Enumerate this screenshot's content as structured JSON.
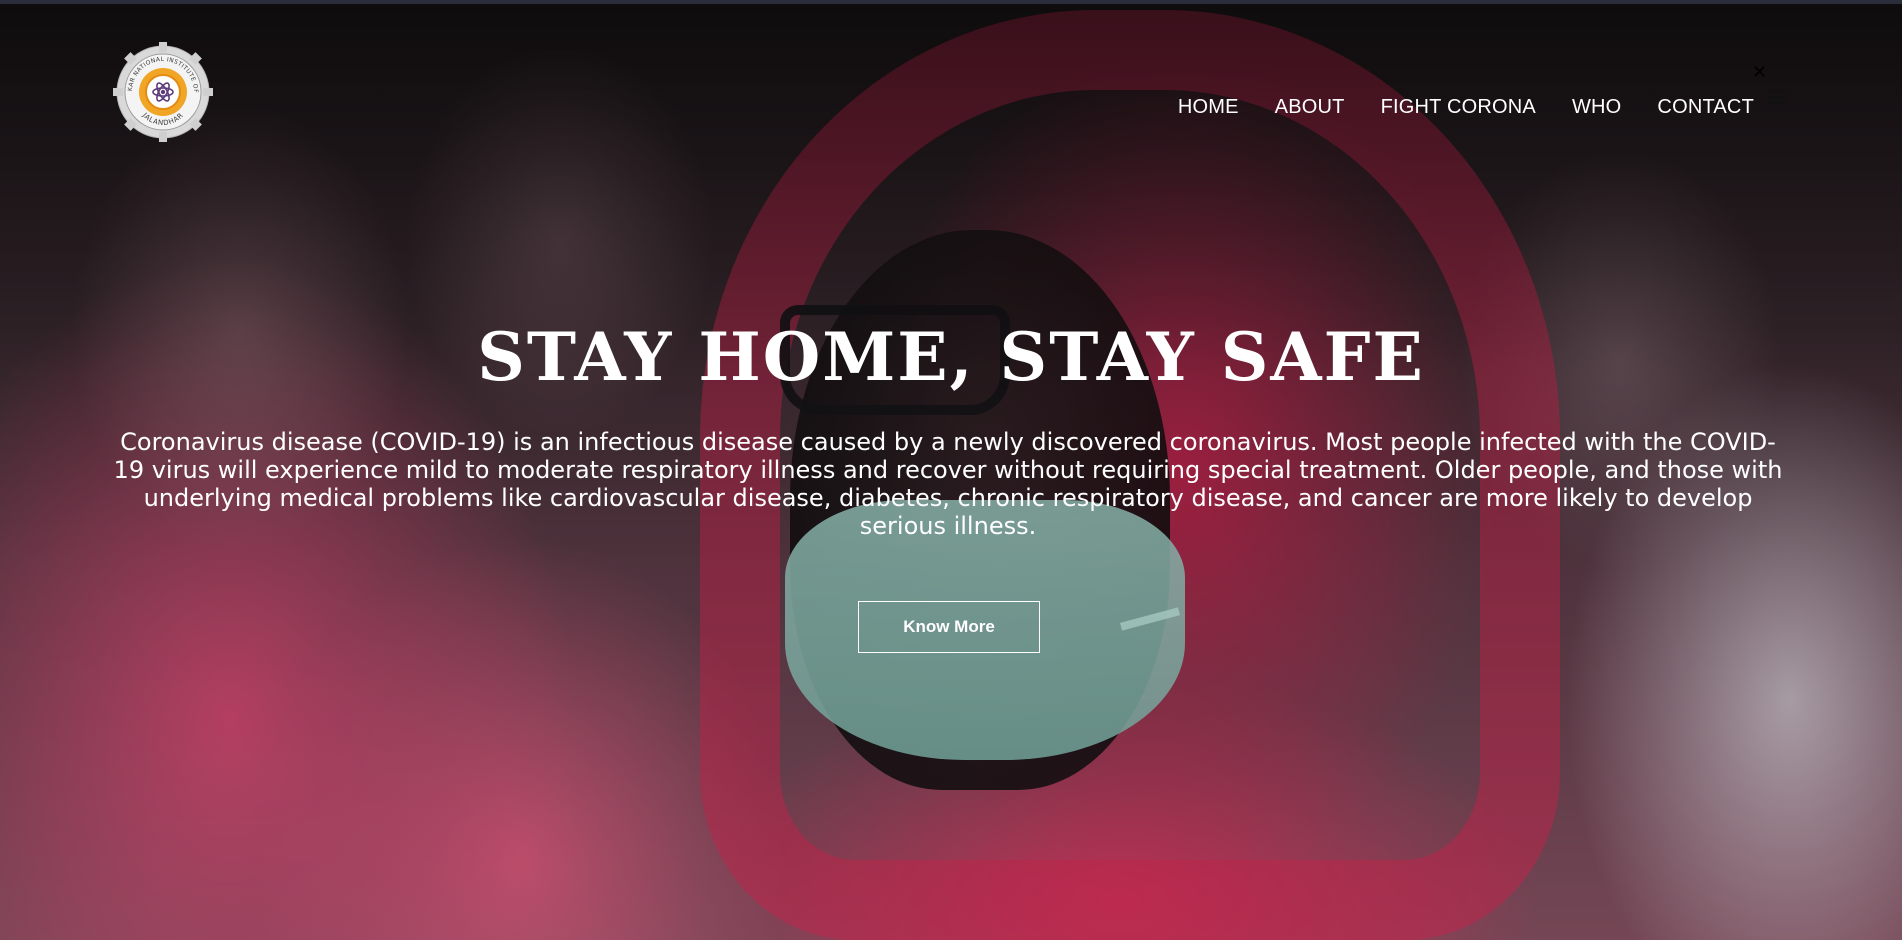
{
  "logo": {
    "alt": "Dr. B R Ambedkar National Institute of Technology Jalandhar emblem",
    "text_top": "DR B R AMBEDKAR NATIONAL INSTITUTE OF TECHNOLOGY",
    "text_bottom": "JALANDHAR"
  },
  "nav": {
    "items": [
      {
        "label": "HOME"
      },
      {
        "label": "ABOUT"
      },
      {
        "label": "FIGHT CORONA"
      },
      {
        "label": "WHO"
      },
      {
        "label": "CONTACT"
      }
    ]
  },
  "icons": {
    "close": "close-icon",
    "menu": "menu-icon"
  },
  "hero": {
    "title": "STAY HOME, STAY SAFE",
    "description": "Coronavirus disease (COVID-19) is an infectious disease caused by a newly discovered coronavirus. Most people infected with the COVID-19 virus will experience mild to moderate respiratory illness and recover without requiring special treatment. Older people, and those with underlying medical problems like cardiovascular disease, diabetes, chronic respiratory disease, and cancer are more likely to develop serious illness.",
    "button_label": "Know More"
  },
  "colors": {
    "hood_pink": "#c8284f",
    "mask_mint": "#9fd1c6",
    "text_white": "#ffffff"
  }
}
